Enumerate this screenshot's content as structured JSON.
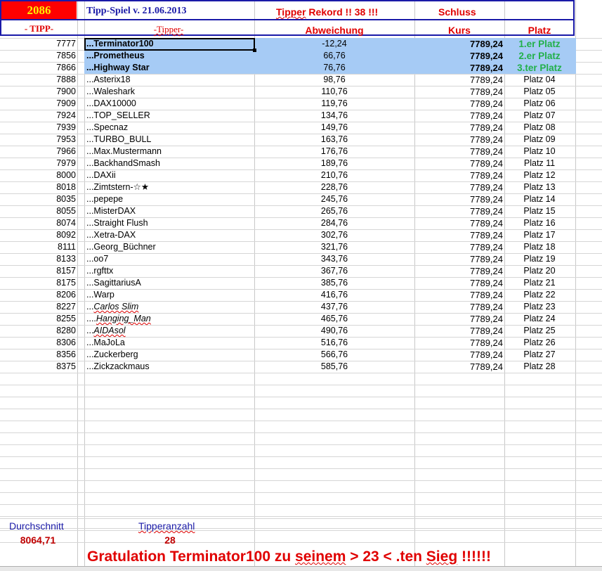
{
  "header": {
    "year": "2086",
    "tipp_label": "- TIPP-",
    "game_title": "Tipp-Spiel v. 21.06.2013",
    "tipper_label": "-Tipper-",
    "record_prefix": "Tipper",
    "record_rest": " Rekord !!  38  !!!",
    "abweichung_label": "Abweichung",
    "schluss_label": "Schluss",
    "kurs_label": "Kurs",
    "platz_label": "Platz"
  },
  "rows": [
    {
      "tipp": "7777",
      "name": "...Terminator100",
      "abw": "-12,24",
      "kurs": "7789,24",
      "platz": "1.er Platz",
      "hl": true
    },
    {
      "tipp": "7856",
      "name": "...Prometheus",
      "abw": "66,76",
      "kurs": "7789,24",
      "platz": "2.er Platz",
      "hl": true
    },
    {
      "tipp": "7866",
      "name": "...Highway Star",
      "abw": "76,76",
      "kurs": "7789,24",
      "platz": "3.ter Platz",
      "hl": true
    },
    {
      "tipp": "7888",
      "name": "...Asterix18",
      "abw": "98,76",
      "kurs": "7789,24",
      "platz": "Platz 04"
    },
    {
      "tipp": "7900",
      "name": "...Waleshark",
      "abw": "110,76",
      "kurs": "7789,24",
      "platz": "Platz 05"
    },
    {
      "tipp": "7909",
      "name": "...DAX10000",
      "abw": "119,76",
      "kurs": "7789,24",
      "platz": "Platz 06"
    },
    {
      "tipp": "7924",
      "name": "...TOP_SELLER",
      "abw": "134,76",
      "kurs": "7789,24",
      "platz": "Platz 07"
    },
    {
      "tipp": "7939",
      "name": "...Specnaz",
      "abw": "149,76",
      "kurs": "7789,24",
      "platz": "Platz 08"
    },
    {
      "tipp": "7953",
      "name": "...TURBO_BULL",
      "abw": "163,76",
      "kurs": "7789,24",
      "platz": "Platz 09"
    },
    {
      "tipp": "7966",
      "name": "...Max.Mustermann",
      "abw": "176,76",
      "kurs": "7789,24",
      "platz": "Platz 10"
    },
    {
      "tipp": "7979",
      "name": "...BackhandSmash",
      "abw": "189,76",
      "kurs": "7789,24",
      "platz": "Platz 11"
    },
    {
      "tipp": "8000",
      "name": "...DAXii",
      "abw": "210,76",
      "kurs": "7789,24",
      "platz": "Platz 12"
    },
    {
      "tipp": "8018",
      "name": "...Zimtstern-☆★",
      "abw": "228,76",
      "kurs": "7789,24",
      "platz": "Platz 13"
    },
    {
      "tipp": "8035",
      "name": "...pepepe",
      "abw": "245,76",
      "kurs": "7789,24",
      "platz": "Platz 14"
    },
    {
      "tipp": "8055",
      "name": "...MisterDAX",
      "abw": "265,76",
      "kurs": "7789,24",
      "platz": "Platz 15"
    },
    {
      "tipp": "8074",
      "name": "...Straight Flush",
      "abw": "284,76",
      "kurs": "7789,24",
      "platz": "Platz 16"
    },
    {
      "tipp": "8092",
      "name": "...Xetra-DAX",
      "abw": "302,76",
      "kurs": "7789,24",
      "platz": "Platz 17"
    },
    {
      "tipp": "8111",
      "name": "...Georg_Büchner",
      "abw": "321,76",
      "kurs": "7789,24",
      "platz": "Platz 18"
    },
    {
      "tipp": "8133",
      "name": "...oo7",
      "abw": "343,76",
      "kurs": "7789,24",
      "platz": "Platz 19"
    },
    {
      "tipp": "8157",
      "name": "...rgfttx",
      "abw": "367,76",
      "kurs": "7789,24",
      "platz": "Platz 20"
    },
    {
      "tipp": "8175",
      "name": "...SagittariusA",
      "abw": "385,76",
      "kurs": "7789,24",
      "platz": "Platz 21"
    },
    {
      "tipp": "8206",
      "name": "...Warp",
      "abw": "416,76",
      "kurs": "7789,24",
      "platz": "Platz 22"
    },
    {
      "tipp": "8227",
      "name_prefix": "...",
      "name_italic": "Carlos Slim",
      "abw": "437,76",
      "kurs": "7789,24",
      "platz": "Platz 23"
    },
    {
      "tipp": "8255",
      "name_prefix": "....",
      "name_italic": "Hanging_Man",
      "abw": "465,76",
      "kurs": "7789,24",
      "platz": "Platz 24"
    },
    {
      "tipp": "8280",
      "name_prefix": "...",
      "name_italic": "AIDAsol",
      "abw": "490,76",
      "kurs": "7789,24",
      "platz": "Platz 25"
    },
    {
      "tipp": "8306",
      "name": "...MaJoLa",
      "abw": "516,76",
      "kurs": "7789,24",
      "platz": "Platz 26"
    },
    {
      "tipp": "8356",
      "name": "...Zuckerberg",
      "abw": "566,76",
      "kurs": "7789,24",
      "platz": "Platz 27"
    },
    {
      "tipp": "8375",
      "name": "...Zickzackmaus",
      "abw": "585,76",
      "kurs": "7789,24",
      "platz": "Platz 28"
    }
  ],
  "footer": {
    "avg_label": "Durchschnitt",
    "avg_value": "8064,71",
    "count_label": "Tipperanzahl",
    "count_value": "28",
    "congrats_start": "Gratulation ",
    "congrats_name": "Terminator100",
    "congrats_mid": " zu ",
    "congrats_w1": "seinem",
    "congrats_tail": " > 23 < .ten ",
    "congrats_w2": "Sieg",
    "congrats_end": " !!!!!!"
  }
}
